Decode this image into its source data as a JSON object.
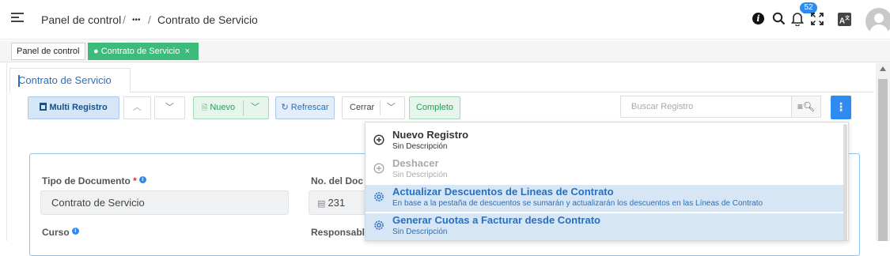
{
  "breadcrumb": {
    "root": "Panel de control",
    "sep": "/",
    "more": "•••",
    "current": "Contrato de Servicio"
  },
  "header": {
    "notifications_count": "52",
    "info_icon": "info-icon",
    "search_icon": "search-icon",
    "bell_icon": "bell-icon",
    "fullscreen_icon": "fullscreen-icon",
    "translate_icon": "translate-icon"
  },
  "tabs": {
    "home": "Panel de control",
    "active": "Contrato de Servicio",
    "active_close": "×"
  },
  "window": {
    "tab_title": "Contrato de Servicio"
  },
  "toolbar": {
    "multi_record": "Multi Registro",
    "new": "Nuevo",
    "refresh": "Refrescar",
    "close": "Cerrar",
    "complete": "Completo",
    "search_placeholder": "Buscar Registro"
  },
  "form": {
    "doc_type_label": "Tipo de Documento",
    "doc_type_required": "*",
    "doc_type_value": "Contrato de Servicio",
    "doc_no_label": "No. del Doc",
    "doc_no_value": "231",
    "course_label": "Curso",
    "responsible_label": "Responsabl"
  },
  "menu": {
    "items": [
      {
        "title": "Nuevo Registro",
        "desc": "Sin Descripción"
      },
      {
        "title": "Deshacer",
        "desc": "Sin Descripción"
      },
      {
        "title": "Actualizar Descuentos de Lineas de Contrato",
        "desc": "En base a la pestaña de descuentos se sumarán y actualizarán los descuentos en las Líneas de Contrato"
      },
      {
        "title": "Generar Cuotas a Facturar desde Contrato",
        "desc": "Sin Descripción"
      }
    ]
  },
  "colors": {
    "accent": "#2e8cf0",
    "green": "#3dbb7a",
    "link": "#2a6fbc",
    "highlight": "#d7e6f5"
  }
}
